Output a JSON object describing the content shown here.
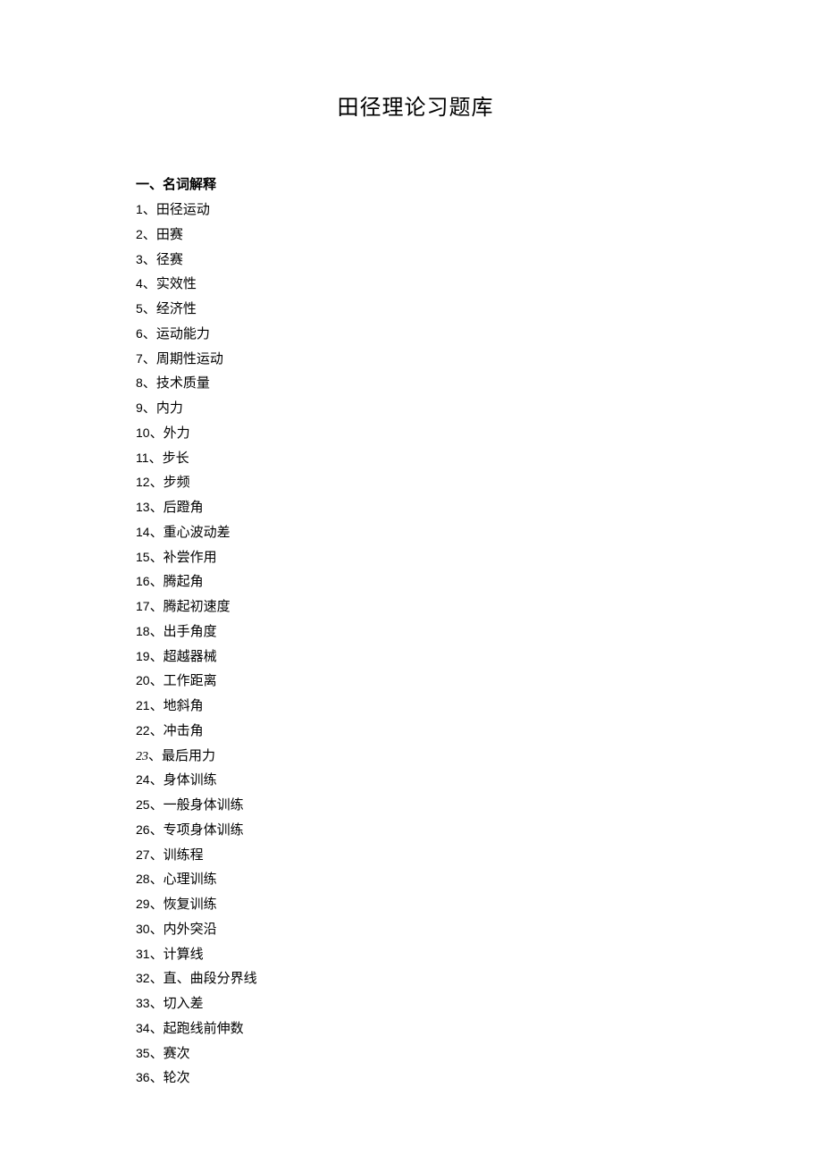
{
  "title": "田径理论习题库",
  "section_heading": "一、名词解释",
  "items": [
    {
      "num": "1",
      "sep": "、",
      "text": "田径运动",
      "italic": false
    },
    {
      "num": "2",
      "sep": "、",
      "text": "田赛",
      "italic": false
    },
    {
      "num": "3",
      "sep": "、",
      "text": "径赛",
      "italic": false
    },
    {
      "num": "4",
      "sep": "、",
      "text": "实效性",
      "italic": false
    },
    {
      "num": "5",
      "sep": "、",
      "text": "经济性",
      "italic": false
    },
    {
      "num": "6",
      "sep": "、",
      "text": "运动能力",
      "italic": false
    },
    {
      "num": "7",
      "sep": "、",
      "text": "周期性运动",
      "italic": false
    },
    {
      "num": "8",
      "sep": "、",
      "text": "技术质量",
      "italic": false
    },
    {
      "num": "9",
      "sep": "、",
      "text": "内力",
      "italic": false
    },
    {
      "num": "10",
      "sep": "、",
      "text": "外力",
      "italic": false
    },
    {
      "num": "11",
      "sep": "、",
      "text": "步长",
      "italic": false
    },
    {
      "num": "12",
      "sep": "、",
      "text": "步频",
      "italic": false
    },
    {
      "num": "13",
      "sep": "、",
      "text": "后蹬角",
      "italic": false
    },
    {
      "num": "14",
      "sep": "、",
      "text": "重心波动差",
      "italic": false
    },
    {
      "num": "15",
      "sep": "、",
      "text": "补尝作用",
      "italic": false
    },
    {
      "num": "16",
      "sep": "、",
      "text": "腾起角",
      "italic": false
    },
    {
      "num": "17",
      "sep": "、",
      "text": "腾起初速度",
      "italic": false
    },
    {
      "num": "18",
      "sep": "、",
      "text": "出手角度",
      "italic": false
    },
    {
      "num": "19",
      "sep": "、",
      "text": "超越器械",
      "italic": false
    },
    {
      "num": "20",
      "sep": "、",
      "text": "工作距离",
      "italic": false
    },
    {
      "num": "21",
      "sep": "、",
      "text": "地斜角",
      "italic": false
    },
    {
      "num": "22",
      "sep": "、",
      "text": "冲击角",
      "italic": false
    },
    {
      "num": "23",
      "sep": "、",
      "text": "最后用力",
      "italic": true
    },
    {
      "num": "24",
      "sep": "、",
      "text": "身体训练",
      "italic": false
    },
    {
      "num": "25",
      "sep": "、",
      "text": "一般身体训练",
      "italic": false
    },
    {
      "num": "26",
      "sep": "、",
      "text": "专项身体训练",
      "italic": false
    },
    {
      "num": "27",
      "sep": "、",
      "text": "训练程",
      "italic": false
    },
    {
      "num": "28",
      "sep": "、",
      "text": "心理训练",
      "italic": false
    },
    {
      "num": "29",
      "sep": "、",
      "text": "恢复训练",
      "italic": false
    },
    {
      "num": "30",
      "sep": "、",
      "text": "内外突沿",
      "italic": false
    },
    {
      "num": "31",
      "sep": "、",
      "text": "计算线",
      "italic": false
    },
    {
      "num": "32",
      "sep": "、",
      "text": "直、曲段分界线",
      "italic": false
    },
    {
      "num": "33",
      "sep": "、",
      "text": "切入差",
      "italic": false
    },
    {
      "num": "34",
      "sep": "、",
      "text": "起跑线前伸数",
      "italic": false
    },
    {
      "num": "35",
      "sep": "、",
      "text": "赛次",
      "italic": false
    },
    {
      "num": "36",
      "sep": "、",
      "text": "轮次",
      "italic": false
    }
  ]
}
